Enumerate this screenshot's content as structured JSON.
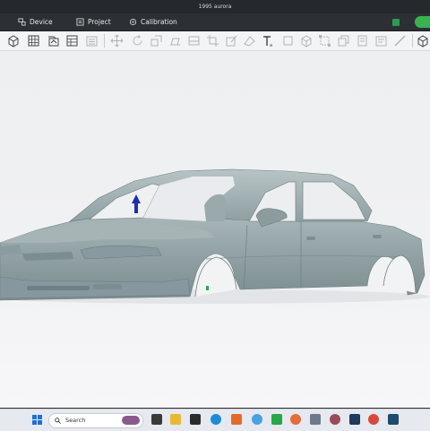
{
  "window": {
    "title": "1995 aurora"
  },
  "menu": {
    "items": [
      {
        "label": "Device",
        "icon": "device-icon"
      },
      {
        "label": "Project",
        "icon": "project-icon"
      },
      {
        "label": "Calibration",
        "icon": "calibration-icon"
      }
    ]
  },
  "toolbar": {
    "tools": [
      "new-project-icon",
      "grid-icon",
      "import-icon",
      "table-icon",
      "list-icon",
      "move-icon",
      "rotate-icon",
      "scale-icon",
      "fill-icon",
      "plane-icon",
      "crop-icon",
      "edit-icon",
      "paint-icon",
      "text-icon",
      "square-icon",
      "cube-icon",
      "resize-icon",
      "stack-icon",
      "copy-icon",
      "ruler-icon",
      "view-cube-icon"
    ]
  },
  "taskbar": {
    "search_label": "Search",
    "apps": [
      "widgets-icon",
      "file-manager-icon",
      "folder-icon",
      "store-icon",
      "edge-icon",
      "office-icon",
      "app-icon",
      "scanner-app-icon",
      "notes-icon",
      "firefox-icon",
      "calculator-icon",
      "game-icon",
      "terminal-icon",
      "chrome-icon",
      "app-tile-icon"
    ]
  },
  "colors": {
    "accent": "#3ab24f",
    "car": "#93a4a6",
    "viewport": "#eeeff1"
  }
}
